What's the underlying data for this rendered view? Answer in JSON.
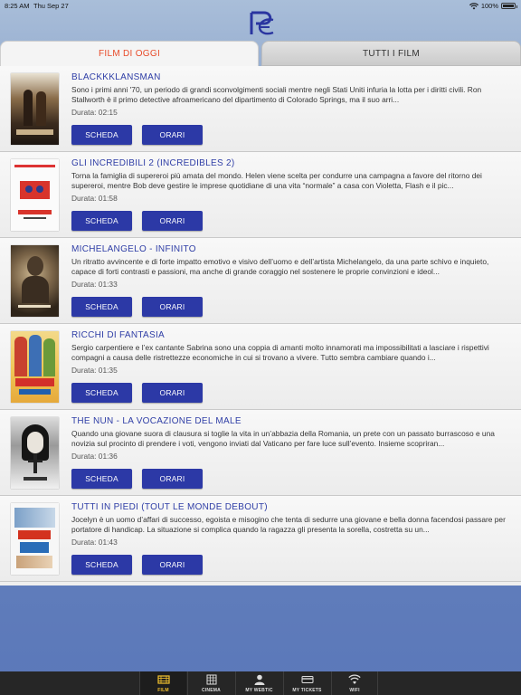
{
  "status_bar": {
    "time": "8:25 AM",
    "date": "Thu Sep 27",
    "battery": "100%"
  },
  "tabs": [
    {
      "label": "FILM DI OGGI",
      "active": true
    },
    {
      "label": "TUTTI I FILM",
      "active": false
    }
  ],
  "movies": [
    {
      "title": "BLACKKKLANSMAN",
      "description": "Sono i primi anni '70, un periodo di grandi sconvolgimenti sociali mentre negli Stati Uniti infuria la lotta per i diritti civili. Ron Stallworth è il primo detective afroamericano del dipartimento di Colorado Springs, ma il suo arri...",
      "duration": "Durata: 02:15",
      "scheda": "SCHEDA",
      "orari": "ORARI"
    },
    {
      "title": "GLI INCREDIBILI 2 (INCREDIBLES 2)",
      "description": "Torna la famiglia di supereroi più amata del mondo. Helen viene scelta per condurre una campagna a favore del ritorno dei supereroi, mentre Bob deve gestire le imprese quotidiane di una vita “normale” a casa con Violetta, Flash e il pic...",
      "duration": "Durata: 01:58",
      "scheda": "SCHEDA",
      "orari": "ORARI"
    },
    {
      "title": "MICHELANGELO - INFINITO",
      "description": "Un ritratto avvincente e di forte impatto emotivo e visivo dell’uomo e dell’artista Michelangelo, da una parte schivo e inquieto, capace di forti contrasti e passioni, ma anche di grande coraggio nel sostenere le proprie convinzioni e ideol...",
      "duration": "Durata: 01:33",
      "scheda": "SCHEDA",
      "orari": "ORARI"
    },
    {
      "title": "RICCHI DI FANTASIA",
      "description": "Sergio carpentiere e l’ex cantante Sabrina sono una coppia di amanti molto innamorati ma impossibilitati a lasciare i rispettivi compagni a causa delle ristrettezze economiche in cui si trovano a vivere. Tutto sembra cambiare quando i...",
      "duration": "Durata: 01:35",
      "scheda": "SCHEDA",
      "orari": "ORARI"
    },
    {
      "title": "THE NUN - LA VOCAZIONE DEL MALE",
      "description": "Quando una giovane suora di clausura si toglie la vita in un’abbazia della Romania, un prete con un passato burrascoso e una novizia sul procinto di prendere i voti, vengono inviati dal Vaticano per fare luce sull’evento. Insieme scopriran...",
      "duration": "Durata: 01:36",
      "scheda": "SCHEDA",
      "orari": "ORARI"
    },
    {
      "title": "TUTTI IN PIEDI (TOUT LE MONDE DEBOUT)",
      "description": "Jocelyn è un uomo d’affari di successo, egoista e misogino che tenta di sedurre una giovane e bella donna facendosi passare per portatore di handicap. La situazione si complica quando la ragazza gli presenta la sorella, costretta su un...",
      "duration": "Durata: 01:43",
      "scheda": "SCHEDA",
      "orari": "ORARI"
    }
  ],
  "bottom_nav": [
    {
      "label": "FILM",
      "icon": "film-icon",
      "active": true
    },
    {
      "label": "CINEMA",
      "icon": "cinema-icon",
      "active": false
    },
    {
      "label": "MY WEBTIC",
      "icon": "user-icon",
      "active": false
    },
    {
      "label": "MY TICKETS",
      "icon": "ticket-icon",
      "active": false
    },
    {
      "label": "WIFI",
      "icon": "wifi-icon",
      "active": false
    }
  ],
  "colors": {
    "accent": "#2c39a6",
    "active_tab_text": "#e84b2a",
    "nav_active": "#f2c12e"
  }
}
